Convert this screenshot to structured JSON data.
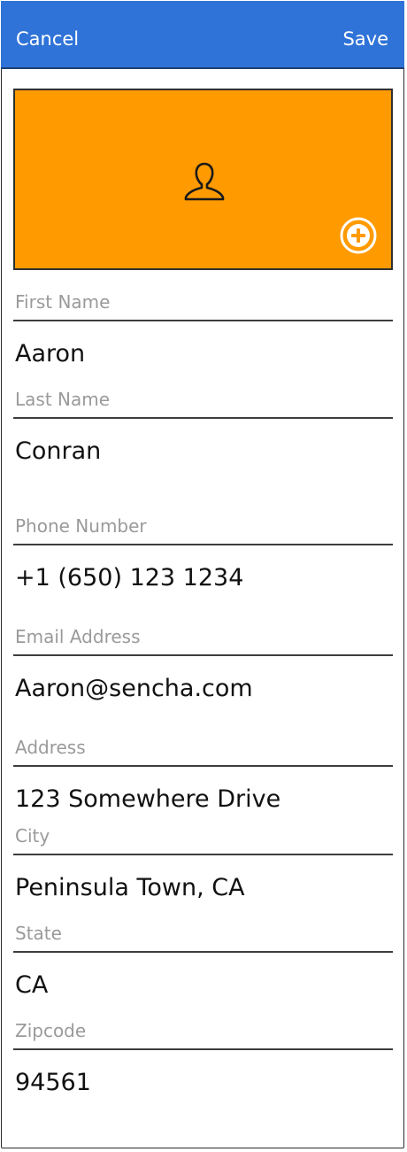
{
  "header": {
    "cancel_label": "Cancel",
    "save_label": "Save",
    "background_color": "#2f73d8"
  },
  "photo": {
    "background_color": "#ff9a00",
    "placeholder_icon": "person-icon",
    "add_icon": "add-circle-icon"
  },
  "fields": [
    {
      "label": "First Name",
      "value": "Aaron"
    },
    {
      "label": "Last Name",
      "value": "Conran"
    },
    {
      "label": "Phone Number",
      "value": "+1 (650) 123 1234"
    },
    {
      "label": "Email Address",
      "value": "Aaron@sencha.com"
    },
    {
      "label": "Address",
      "value": "123 Somewhere Drive"
    },
    {
      "label": "City",
      "value": "Peninsula Town, CA"
    },
    {
      "label": "State",
      "value": "CA"
    },
    {
      "label": "Zipcode",
      "value": "94561"
    }
  ]
}
